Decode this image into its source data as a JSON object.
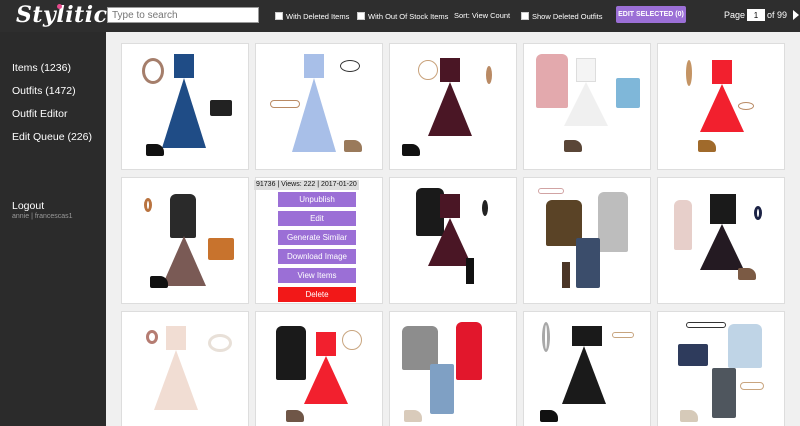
{
  "app": {
    "logo_text": "Stylitics"
  },
  "toolbar": {
    "search_placeholder": "Type to search",
    "with_deleted_items": "With Deleted Items",
    "with_out_of_stock_items": "With Out Of Stock Items",
    "sort_label": "Sort: View Count",
    "show_deleted_outfits": "Show Deleted Outfits",
    "edit_selected": "EDIT SELECTED (0)",
    "page_label": "Page",
    "page_value": "1",
    "page_of": "of 99"
  },
  "sidebar": {
    "items": [
      {
        "label": "Items (1236)"
      },
      {
        "label": "Outfits (1472)"
      },
      {
        "label": "Outfit Editor"
      },
      {
        "label": "Edit Queue (226)"
      }
    ],
    "user": "annie | francescas1",
    "logout": "Logout"
  },
  "hover_card": {
    "info": "91736 | Views: 222 | 2017-01-20",
    "actions": [
      "Unpublish",
      "Edit",
      "Generate Similar",
      "Download Image",
      "View Items",
      "Delete"
    ]
  },
  "colors": {
    "accent": "#9b6fd6",
    "danger": "#f21818",
    "topbar": "#2e2e2e",
    "sidebar": "#2b2b2b"
  },
  "outfits": [
    {
      "desc": "blue dress, black clutch, black heels, necklace"
    },
    {
      "desc": "light blue dress, cat ear headband, tan sandals"
    },
    {
      "desc": "burgundy lace dress, black strappy heels, necklace"
    },
    {
      "desc": "pink jacket, white dress, blue tote, boots"
    },
    {
      "desc": "red dress, tan wedges, bracelet"
    },
    {
      "desc": "black patterned top, tan crossbody, black heels"
    },
    {
      "desc": "hovered outfit card"
    },
    {
      "desc": "black blazer, burgundy dress, black boots"
    },
    {
      "desc": "olive sweater, jeans, grey cardigan, boots"
    },
    {
      "desc": "pink scarf, black dress, brown booties"
    },
    {
      "desc": "white lace dress, earrings, bangles"
    },
    {
      "desc": "black cardigan, red dress, booties"
    },
    {
      "desc": "grey sweatshirt, red vest, floral jeans"
    },
    {
      "desc": "black skirt, earrings, choker, heels"
    },
    {
      "desc": "light blue sweater, grey jeans, blue bag"
    }
  ]
}
